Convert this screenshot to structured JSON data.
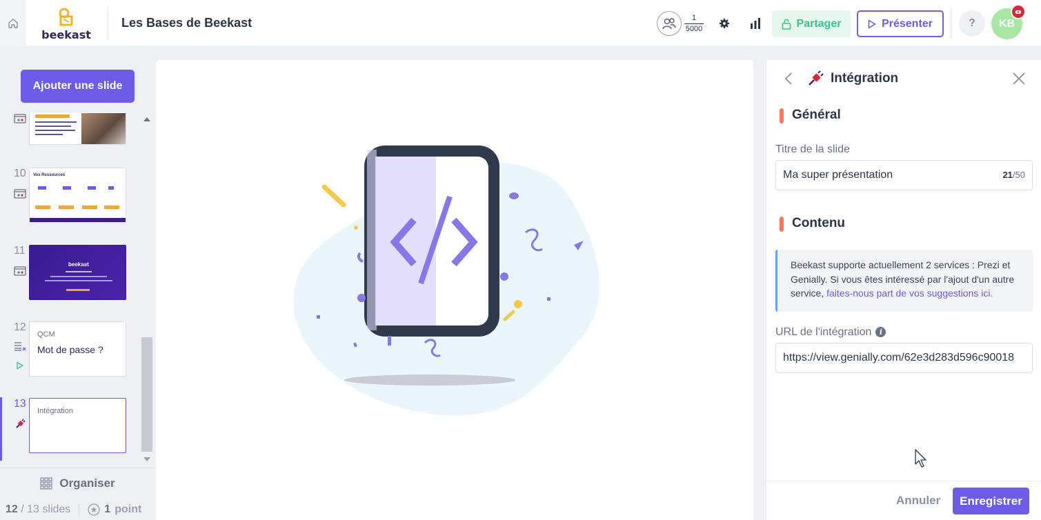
{
  "header": {
    "logo_text": "beekast",
    "presentation_title": "Les Bases de Beekast",
    "participants_current": "1",
    "participants_max": "5000",
    "share_label": "Partager",
    "present_label": "Présenter",
    "help_label": "?",
    "avatar_initials": "KB"
  },
  "sidebar": {
    "add_slide_label": "Ajouter une slide",
    "slides": [
      {
        "number": "",
        "type": "content"
      },
      {
        "number": "10",
        "type": "content",
        "thumb_title": "Vos Ressources"
      },
      {
        "number": "11",
        "type": "content",
        "thumb_title": "beekast"
      },
      {
        "number": "12",
        "type": "qcm",
        "label": "QCM",
        "title": "Mot de passe ?"
      },
      {
        "number": "13",
        "type": "integration",
        "label": "Intégration",
        "active": true
      }
    ],
    "organiser_label": "Organiser",
    "slides_current": "12",
    "slides_total": "/ 13 slides",
    "points_value": "1",
    "points_label": "point"
  },
  "panel": {
    "title": "Intégration",
    "section_general": "Général",
    "slide_title_label": "Titre de la slide",
    "slide_title_value": "Ma super présentation",
    "char_count_current": "21",
    "char_count_max": "/50",
    "section_content": "Contenu",
    "info_text": "Beekast supporte actuellement 2 services : Prezi et Genially. Si vous êtes intéressé par l'ajout d'un autre service, ",
    "info_link": "faites-nous part de vos suggestions ici.",
    "url_label": "URL de l'intégration",
    "url_value": "https://view.genially.com/62e3d283d596c90018",
    "cancel_label": "Annuler",
    "save_label": "Enregistrer"
  },
  "colors": {
    "accent": "#6c5ce7",
    "share_green": "#3cc48b",
    "section_marker": "#f07c5a",
    "avatar_bg": "#a8e6a3",
    "badge_red": "#d62839"
  }
}
